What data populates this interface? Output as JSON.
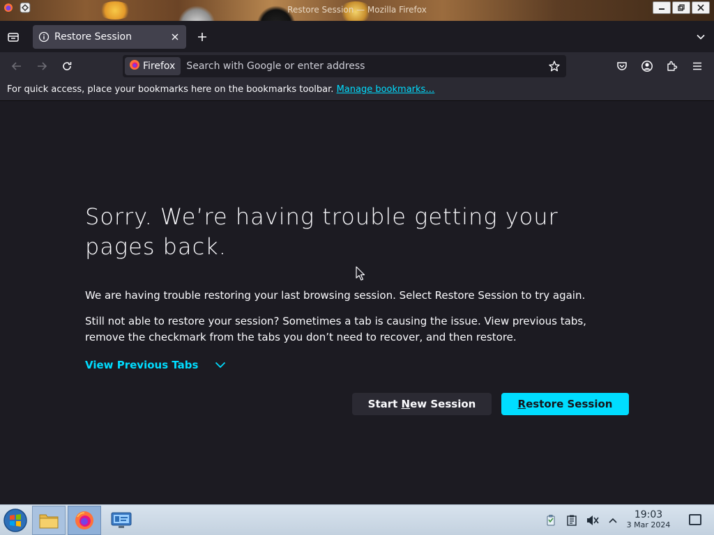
{
  "window": {
    "title": "Restore Session — Mozilla Firefox",
    "controls": [
      "minimize",
      "restore",
      "close"
    ]
  },
  "tabs": [
    {
      "label": "Restore Session",
      "icon": "info-icon",
      "active": true
    }
  ],
  "navbar": {
    "identity_label": "Firefox",
    "url_placeholder": "Search with Google or enter address",
    "url_value": ""
  },
  "bookmarks_bar": {
    "text": "For quick access, place your bookmarks here on the bookmarks toolbar.",
    "link": "Manage bookmarks…"
  },
  "page": {
    "headline": "Sorry. We’re having trouble getting your pages back.",
    "paragraph1": "We are having trouble restoring your last browsing session. Select Restore Session to try again.",
    "paragraph2": "Still not able to restore your session? Sometimes a tab is causing the issue. View previous tabs, remove the checkmark from the tabs you don’t need to recover, and then restore.",
    "view_previous_tabs": "View Previous Tabs",
    "start_new_session": {
      "pre": "Start ",
      "accel": "N",
      "post": "ew Session"
    },
    "restore_session": {
      "pre": "",
      "accel": "R",
      "post": "estore Session"
    }
  },
  "taskbar": {
    "apps": [
      "file-manager-icon",
      "firefox-icon",
      "system-monitor-icon"
    ],
    "tray": [
      "clipboard-icon",
      "notes-icon",
      "volume-muted-icon",
      "tray-expand-icon"
    ],
    "time": "19:03",
    "date": "3 Mar 2024"
  },
  "colors": {
    "accent": "#00ddff",
    "page_bg": "#1c1b22",
    "toolbar_bg": "#2b2a33",
    "tab_active_bg": "#42414d"
  }
}
